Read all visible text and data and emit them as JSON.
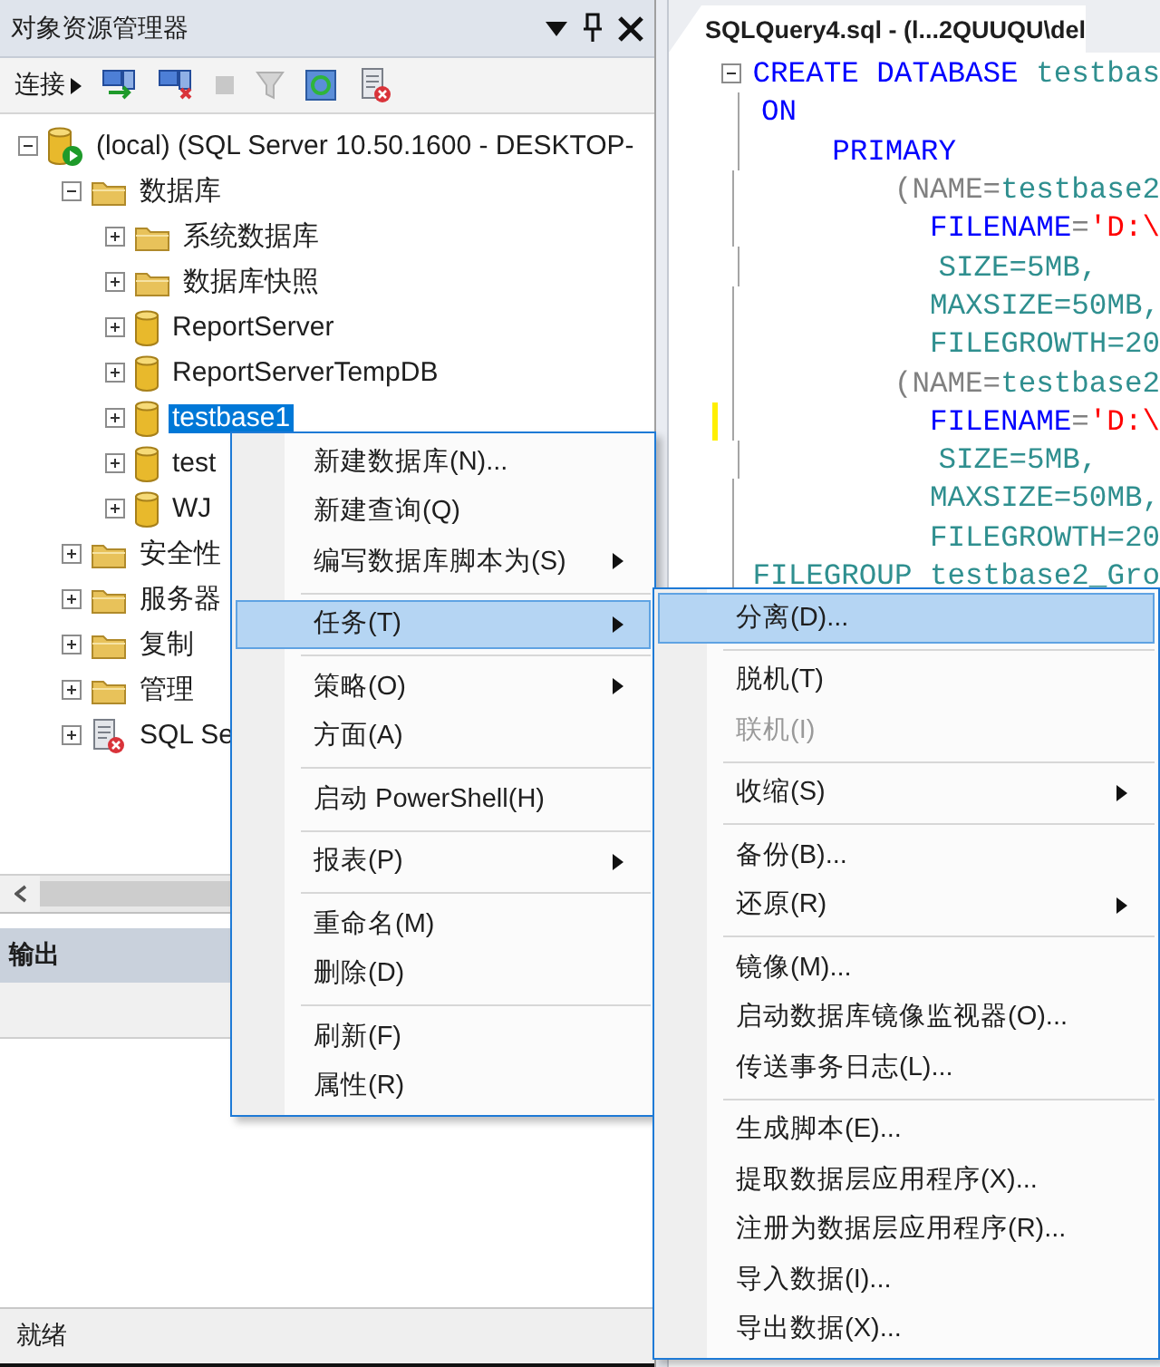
{
  "explorer": {
    "title": "对象资源管理器",
    "toolbar": {
      "connect_label": "连接"
    },
    "tree": [
      {
        "label": "(local) (SQL Server 10.50.1600 - DESKTOP-",
        "kind": "server",
        "expanded": true,
        "selected": false,
        "children": [
          {
            "label": "数据库",
            "kind": "folder",
            "expanded": true,
            "selected": false,
            "children": [
              {
                "label": "系统数据库",
                "kind": "folder",
                "expanded": false,
                "selected": false
              },
              {
                "label": "数据库快照",
                "kind": "folder",
                "expanded": false,
                "selected": false
              },
              {
                "label": "ReportServer",
                "kind": "database",
                "expanded": false,
                "selected": false
              },
              {
                "label": "ReportServerTempDB",
                "kind": "database",
                "expanded": false,
                "selected": false
              },
              {
                "label": "testbase1",
                "kind": "database",
                "expanded": false,
                "selected": true
              },
              {
                "label": "test",
                "kind": "database",
                "expanded": false,
                "selected": false
              },
              {
                "label": "WJ",
                "kind": "database",
                "expanded": false,
                "selected": false
              }
            ]
          },
          {
            "label": "安全性",
            "kind": "folder",
            "expanded": false,
            "selected": false
          },
          {
            "label": "服务器",
            "kind": "folder",
            "expanded": false,
            "selected": false
          },
          {
            "label": "复制",
            "kind": "folder",
            "expanded": false,
            "selected": false
          },
          {
            "label": "管理",
            "kind": "folder",
            "expanded": false,
            "selected": false
          },
          {
            "label": "SQL Se",
            "kind": "agent",
            "expanded": false,
            "selected": false
          }
        ]
      }
    ]
  },
  "output": {
    "title": "输出"
  },
  "status_bar": "就绪",
  "editor": {
    "tab_title": "SQLQuery4.sql - (l...2QUUQU\\del",
    "lines": [
      {
        "changed": false,
        "collapsible": true,
        "tokens": [
          {
            "text": "CREATE DATABASE",
            "kind": "keyword"
          },
          {
            "text": " testbas",
            "kind": "ident"
          }
        ]
      },
      {
        "changed": false,
        "collapsible": false,
        "tokens": [
          {
            "text": "ON",
            "kind": "keyword"
          }
        ]
      },
      {
        "changed": false,
        "collapsible": false,
        "tokens": [
          {
            "text": "    PRIMARY",
            "kind": "keyword"
          }
        ]
      },
      {
        "changed": false,
        "collapsible": false,
        "tokens": [
          {
            "text": "        (NAME=",
            "kind": "punct"
          },
          {
            "text": "testbase2",
            "kind": "ident"
          }
        ]
      },
      {
        "changed": false,
        "collapsible": false,
        "tokens": [
          {
            "text": "          FILENAME",
            "kind": "keyword"
          },
          {
            "text": "=",
            "kind": "punct"
          },
          {
            "text": "'D:\\",
            "kind": "string"
          }
        ]
      },
      {
        "changed": false,
        "collapsible": false,
        "tokens": [
          {
            "text": "          SIZE=5MB,",
            "kind": "ident"
          }
        ]
      },
      {
        "changed": false,
        "collapsible": false,
        "tokens": [
          {
            "text": "          MAXSIZE=50MB,",
            "kind": "ident"
          }
        ]
      },
      {
        "changed": false,
        "collapsible": false,
        "tokens": [
          {
            "text": "          FILEGROWTH=20",
            "kind": "ident"
          }
        ]
      },
      {
        "changed": false,
        "collapsible": false,
        "tokens": [
          {
            "text": "        (NAME=",
            "kind": "punct"
          },
          {
            "text": "testbase2",
            "kind": "ident"
          }
        ]
      },
      {
        "changed": true,
        "collapsible": false,
        "tokens": [
          {
            "text": "          FILENAME",
            "kind": "keyword"
          },
          {
            "text": "=",
            "kind": "punct"
          },
          {
            "text": "'D:\\",
            "kind": "string"
          }
        ]
      },
      {
        "changed": false,
        "collapsible": false,
        "tokens": [
          {
            "text": "          SIZE=5MB,",
            "kind": "ident"
          }
        ]
      },
      {
        "changed": false,
        "collapsible": false,
        "tokens": [
          {
            "text": "          MAXSIZE=50MB,",
            "kind": "ident"
          }
        ]
      },
      {
        "changed": false,
        "collapsible": false,
        "tokens": [
          {
            "text": "          FILEGROWTH=20",
            "kind": "ident"
          }
        ]
      },
      {
        "changed": false,
        "collapsible": false,
        "tokens": [
          {
            "text": "FILEGROUP testbase2_Gro",
            "kind": "ident"
          }
        ]
      }
    ]
  },
  "context_menu": {
    "items": [
      {
        "kind": "item",
        "label": "新建数据库(N)...",
        "has_submenu": false,
        "selected": false,
        "disabled": false
      },
      {
        "kind": "item",
        "label": "新建查询(Q)",
        "has_submenu": false,
        "selected": false,
        "disabled": false
      },
      {
        "kind": "item",
        "label": "编写数据库脚本为(S)",
        "has_submenu": true,
        "selected": false,
        "disabled": false
      },
      {
        "kind": "separator"
      },
      {
        "kind": "item",
        "label": "任务(T)",
        "has_submenu": true,
        "selected": true,
        "disabled": false
      },
      {
        "kind": "separator"
      },
      {
        "kind": "item",
        "label": "策略(O)",
        "has_submenu": true,
        "selected": false,
        "disabled": false
      },
      {
        "kind": "item",
        "label": "方面(A)",
        "has_submenu": false,
        "selected": false,
        "disabled": false
      },
      {
        "kind": "separator"
      },
      {
        "kind": "item",
        "label": "启动 PowerShell(H)",
        "has_submenu": false,
        "selected": false,
        "disabled": false
      },
      {
        "kind": "separator"
      },
      {
        "kind": "item",
        "label": "报表(P)",
        "has_submenu": true,
        "selected": false,
        "disabled": false
      },
      {
        "kind": "separator"
      },
      {
        "kind": "item",
        "label": "重命名(M)",
        "has_submenu": false,
        "selected": false,
        "disabled": false
      },
      {
        "kind": "item",
        "label": "删除(D)",
        "has_submenu": false,
        "selected": false,
        "disabled": false
      },
      {
        "kind": "separator"
      },
      {
        "kind": "item",
        "label": "刷新(F)",
        "has_submenu": false,
        "selected": false,
        "disabled": false
      },
      {
        "kind": "item",
        "label": "属性(R)",
        "has_submenu": false,
        "selected": false,
        "disabled": false
      }
    ]
  },
  "submenu": {
    "items": [
      {
        "kind": "item",
        "label": "分离(D)...",
        "has_submenu": false,
        "selected": true,
        "disabled": false
      },
      {
        "kind": "separator"
      },
      {
        "kind": "item",
        "label": "脱机(T)",
        "has_submenu": false,
        "selected": false,
        "disabled": false
      },
      {
        "kind": "item",
        "label": "联机(I)",
        "has_submenu": false,
        "selected": false,
        "disabled": true
      },
      {
        "kind": "separator"
      },
      {
        "kind": "item",
        "label": "收缩(S)",
        "has_submenu": true,
        "selected": false,
        "disabled": false
      },
      {
        "kind": "separator"
      },
      {
        "kind": "item",
        "label": "备份(B)...",
        "has_submenu": false,
        "selected": false,
        "disabled": false
      },
      {
        "kind": "item",
        "label": "还原(R)",
        "has_submenu": true,
        "selected": false,
        "disabled": false
      },
      {
        "kind": "separator"
      },
      {
        "kind": "item",
        "label": "镜像(M)...",
        "has_submenu": false,
        "selected": false,
        "disabled": false
      },
      {
        "kind": "item",
        "label": "启动数据库镜像监视器(O)...",
        "has_submenu": false,
        "selected": false,
        "disabled": false
      },
      {
        "kind": "item",
        "label": "传送事务日志(L)...",
        "has_submenu": false,
        "selected": false,
        "disabled": false
      },
      {
        "kind": "separator"
      },
      {
        "kind": "item",
        "label": "生成脚本(E)...",
        "has_submenu": false,
        "selected": false,
        "disabled": false
      },
      {
        "kind": "item",
        "label": "提取数据层应用程序(X)...",
        "has_submenu": false,
        "selected": false,
        "disabled": false
      },
      {
        "kind": "item",
        "label": "注册为数据层应用程序(R)...",
        "has_submenu": false,
        "selected": false,
        "disabled": false
      },
      {
        "kind": "item",
        "label": "导入数据(I)...",
        "has_submenu": false,
        "selected": false,
        "disabled": false
      },
      {
        "kind": "item",
        "label": "导出数据(X)...",
        "has_submenu": false,
        "selected": false,
        "disabled": false
      }
    ]
  }
}
